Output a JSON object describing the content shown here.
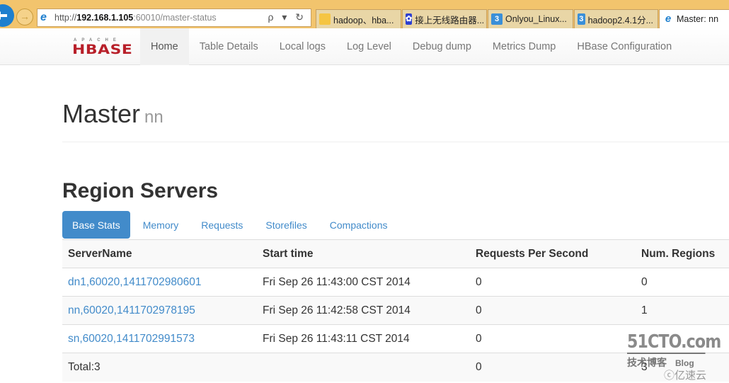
{
  "browser": {
    "url_prefix": "http://",
    "url_host": "192.168.1.105",
    "url_port": ":60010",
    "url_path": "/master-status",
    "address_tools": "ρ ▾ ↻",
    "tabs": [
      {
        "label": "hadoop、hba...",
        "icon": "blog-icon",
        "active": false
      },
      {
        "label": "接上无线路由器...",
        "icon": "baidu-paw-icon",
        "active": false
      },
      {
        "label": "Onlyou_Linux...",
        "icon": "site-3-icon",
        "active": false
      },
      {
        "label": "hadoop2.4.1分...",
        "icon": "site-3-icon",
        "active": false
      },
      {
        "label": "Master: nn",
        "icon": "ie-icon",
        "active": true
      }
    ]
  },
  "navbar": {
    "logo_top": "APACHE",
    "logo_main": "HBASE",
    "items": [
      {
        "label": "Home",
        "active": true
      },
      {
        "label": "Table Details",
        "active": false
      },
      {
        "label": "Local logs",
        "active": false
      },
      {
        "label": "Log Level",
        "active": false
      },
      {
        "label": "Debug dump",
        "active": false
      },
      {
        "label": "Metrics Dump",
        "active": false
      },
      {
        "label": "HBase Configuration",
        "active": false
      }
    ]
  },
  "header": {
    "title": "Master",
    "subtitle": "nn"
  },
  "region_servers": {
    "title": "Region Servers",
    "tabs": [
      {
        "label": "Base Stats",
        "active": true
      },
      {
        "label": "Memory",
        "active": false
      },
      {
        "label": "Requests",
        "active": false
      },
      {
        "label": "Storefiles",
        "active": false
      },
      {
        "label": "Compactions",
        "active": false
      }
    ],
    "columns": [
      "ServerName",
      "Start time",
      "Requests Per Second",
      "Num. Regions"
    ],
    "rows": [
      {
        "server": "dn1,60020,1411702980601",
        "start": "Fri Sep 26 11:43:00 CST 2014",
        "rps": "0",
        "regions": "0"
      },
      {
        "server": "nn,60020,1411702978195",
        "start": "Fri Sep 26 11:42:58 CST 2014",
        "rps": "0",
        "regions": "1"
      },
      {
        "server": "sn,60020,1411702991573",
        "start": "Fri Sep 26 11:43:11 CST 2014",
        "rps": "0",
        "regions": ""
      }
    ],
    "total": {
      "label": "Total:3",
      "rps": "0",
      "regions": "3"
    }
  },
  "watermark": {
    "line1": "51CTO.com",
    "line2": "技术博客",
    "line2b": "Blog",
    "line3": "ⓒ亿速云"
  }
}
